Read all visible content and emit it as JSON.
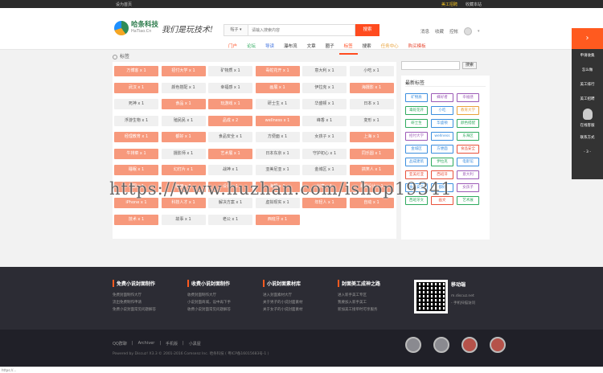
{
  "topbar": {
    "set_home": "设为首页",
    "staff_login": "美工招聘",
    "favorite": "收藏本站"
  },
  "logo": {
    "cn": "哈条科技",
    "en": "HaTiao.Cn",
    "slogan": "我们是玩技术!"
  },
  "search": {
    "scope": "帖子",
    "placeholder": "请输入搜索内容",
    "button": "搜索"
  },
  "user": {
    "links": [
      "消息",
      "收藏",
      "控帐"
    ],
    "caret": "▾"
  },
  "nav": {
    "items": [
      "门户",
      "论坛",
      "导读",
      "瀑布流",
      "文章",
      "圈子",
      "标签",
      "搜索",
      "任务中心",
      "购买模板"
    ],
    "active_index": 6
  },
  "breadcrumb": {
    "label": "标签"
  },
  "tags": [
    {
      "label": "万博客 x 1",
      "hot": true
    },
    {
      "label": "招付大学 x 1",
      "hot": true
    },
    {
      "label": "矿物质 x 1",
      "hot": false
    },
    {
      "label": "毒蛇花开 x 1",
      "hot": true
    },
    {
      "label": "意大利 x 1",
      "hot": false
    },
    {
      "label": "小吃 x 1",
      "hot": false
    },
    {
      "label": "武汉 x 1",
      "hot": true
    },
    {
      "label": "颜色搭配 x 1",
      "hot": false
    },
    {
      "label": "幸福感 x 1",
      "hot": false
    },
    {
      "label": "画展 x 1",
      "hot": true
    },
    {
      "label": "伊拉克 x 1",
      "hot": false
    },
    {
      "label": "海摄影 x 1",
      "hot": true
    },
    {
      "label": "死神 x 1",
      "hot": false
    },
    {
      "label": "食品 x 1",
      "hot": true
    },
    {
      "label": "玩游戏 x 1",
      "hot": true
    },
    {
      "label": "研士生 x 1",
      "hot": false
    },
    {
      "label": "华盛顿 x 1",
      "hot": false
    },
    {
      "label": "日本 x 1",
      "hot": false
    },
    {
      "label": "浮游生物 x 1",
      "hot": false
    },
    {
      "label": "殖民民 x 1",
      "hot": false
    },
    {
      "label": "品成 x 2",
      "hot": true
    },
    {
      "label": "wellness x 1",
      "hot": true
    },
    {
      "label": "峰香 x 1",
      "hot": false
    },
    {
      "label": "变形 x 1",
      "hot": false
    },
    {
      "label": "经理教育 x 1",
      "hot": true
    },
    {
      "label": "都好 x 1",
      "hot": true
    },
    {
      "label": "食品安全 x 1",
      "hot": false
    },
    {
      "label": "方便面 x 1",
      "hot": false
    },
    {
      "label": "女孩子 x 1",
      "hot": false
    },
    {
      "label": "上海 x 1",
      "hot": true
    },
    {
      "label": "牛排菜 x 1",
      "hot": true
    },
    {
      "label": "摄影师 x 1",
      "hot": false
    },
    {
      "label": "艺术展 x 1",
      "hot": true
    },
    {
      "label": "日本东京 x 1",
      "hot": false
    },
    {
      "label": "守护初心 x 1",
      "hot": false
    },
    {
      "label": "同乐圆 x 1",
      "hot": true
    },
    {
      "label": "睡眠 x 1",
      "hot": true
    },
    {
      "label": "幻灯片 x 1",
      "hot": true
    },
    {
      "label": "战神 x 1",
      "hot": false
    },
    {
      "label": "亚美尼亚 x 1",
      "hot": false
    },
    {
      "label": "金城区 x 1",
      "hot": false
    },
    {
      "label": "搞笑人 x 1",
      "hot": true
    },
    {
      "label": "中国 x 1",
      "hot": true
    },
    {
      "label": "画册 x 1",
      "hot": true
    },
    {
      "label": "设计 x 1",
      "hot": true
    },
    {
      "label": "海报 x 1",
      "hot": true
    },
    {
      "label": "创意 x 1",
      "hot": true
    },
    {
      "label": "海报设计 x 1",
      "hot": true
    },
    {
      "label": "iPhone x 1",
      "hot": true
    },
    {
      "label": "科技人才 x 1",
      "hot": true
    },
    {
      "label": "解决方案 x 1",
      "hot": false
    },
    {
      "label": "虚拟现实 x 1",
      "hot": false
    },
    {
      "label": "年轻人 x 1",
      "hot": true
    },
    {
      "label": "自动 x 1",
      "hot": true
    },
    {
      "label": "技术 x 1",
      "hot": true
    },
    {
      "label": "故事 x 1",
      "hot": false
    },
    {
      "label": "老公 x 1",
      "hot": false
    },
    {
      "label": "西班牙 x 1",
      "hot": true
    }
  ],
  "sidebar": {
    "search_button": "搜索",
    "title": "最新标签",
    "tags": [
      {
        "label": "矿物质",
        "color": "#3b8ede"
      },
      {
        "label": "蜂好者",
        "color": "#9b59b6"
      },
      {
        "label": "幸福感",
        "color": "#9b59b6"
      },
      {
        "label": "毒蛇花开",
        "color": "#2eaa5e"
      },
      {
        "label": "小吃",
        "color": "#3b8ede"
      },
      {
        "label": "教育大学",
        "color": "#e8a23a"
      },
      {
        "label": "研士生",
        "color": "#2eaa5e"
      },
      {
        "label": "华盛顿",
        "color": "#3b8ede"
      },
      {
        "label": "颜色搭配",
        "color": "#2eaa5e"
      },
      {
        "label": "招付大学",
        "color": "#9b59b6"
      },
      {
        "label": "wellness",
        "color": "#3b8ede"
      },
      {
        "label": "东海区",
        "color": "#2eaa5e"
      },
      {
        "label": "金城区",
        "color": "#3b8ede"
      },
      {
        "label": "方便面",
        "color": "#3b8ede"
      },
      {
        "label": "食品安全",
        "color": "#e8503a"
      },
      {
        "label": "品成建筑",
        "color": "#3b8ede"
      },
      {
        "label": "伊拉克",
        "color": "#2eaa5e"
      },
      {
        "label": "电影馆",
        "color": "#3b8ede"
      },
      {
        "label": "亚美尼亚",
        "color": "#e8503a"
      },
      {
        "label": "西班牙",
        "color": "#e8503a"
      },
      {
        "label": "意大利",
        "color": "#9b59b6"
      },
      {
        "label": "食品安全",
        "color": "#3b8ede"
      },
      {
        "label": "都好",
        "color": "#3b8ede"
      },
      {
        "label": "女孩子",
        "color": "#9b59b6"
      },
      {
        "label": "西班牙文",
        "color": "#2eaa5e"
      },
      {
        "label": "画文",
        "color": "#e8503a"
      },
      {
        "label": "艺术展",
        "color": "#2eaa5e"
      }
    ]
  },
  "floatbar": {
    "items": [
      "申请收集",
      "怎么做",
      "美工排行",
      "美工招聘"
    ],
    "qq_label": "在线客服",
    "contact": "联系方式",
    "more": "- 3 -"
  },
  "watermark": "https://www.huzhan.com/ishop19341",
  "footer": {
    "columns": [
      {
        "title": "免费小说封面制作",
        "links": [
          "免费封面制作大厅",
          "流出免费制作申请",
          "免费小说封面常见问题解答"
        ]
      },
      {
        "title": "收费小说封面制作",
        "links": [
          "收费封面制作大厅",
          "小说封面商城，设中再下手",
          "收费小说封面常见问题解答"
        ]
      },
      {
        "title": "小说封面素材库",
        "links": [
          "进入封面素材大厅",
          "关于男子的小说封面素材",
          "关于女子的小说封面素材"
        ]
      },
      {
        "title": "封面美工成神之路",
        "links": [
          "进入新手美工专区",
          "我要加入新手美工",
          "新加美工接单时可享服务"
        ]
      }
    ],
    "mobile": {
      "title": "移动端",
      "links": [
        "m.discuz.net",
        "- 手机扫描访问"
      ]
    },
    "bottom_links": [
      "QQ群聊",
      "Archiver",
      "手机版",
      "小黑屋"
    ],
    "copyright": "Powered by Discuz! X3.3 © 2001-2016 Comsenz Inc. 哈条科技 ( 粤ICP备16015683号-1 )"
  },
  "status_bar": "https://..."
}
